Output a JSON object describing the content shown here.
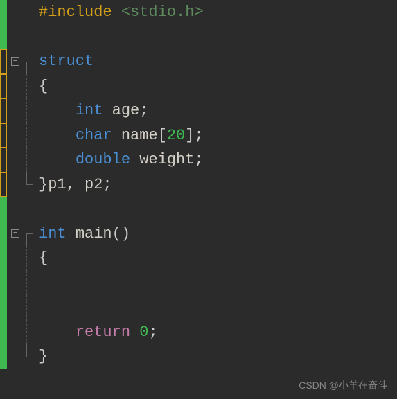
{
  "code": {
    "line1": {
      "preproc": "#include ",
      "inc_open": "<",
      "inc_path": "stdio.h",
      "inc_close": ">"
    },
    "line3": {
      "kw_struct": "struct"
    },
    "line4": {
      "brace_open": "{"
    },
    "line5": {
      "indent": "    ",
      "type": "int",
      "sp": " ",
      "ident": "age",
      "semi": ";"
    },
    "line6": {
      "indent": "    ",
      "type": "char",
      "sp": " ",
      "ident": "name",
      "bracket_open": "[",
      "num": "20",
      "bracket_close": "]",
      "semi": ";"
    },
    "line7": {
      "indent": "    ",
      "type": "double",
      "sp": " ",
      "ident": "weight",
      "semi": ";"
    },
    "line8": {
      "brace_close": "}",
      "vars": "p1, p2",
      "semi": ";"
    },
    "line10": {
      "type": "int",
      "sp": " ",
      "func": "main",
      "parens": "()"
    },
    "line11": {
      "brace_open": "{"
    },
    "line14": {
      "indent": "    ",
      "ret": "return",
      "sp": " ",
      "num": "0",
      "semi": ";"
    },
    "line15": {
      "brace_close": "}"
    }
  },
  "fold": {
    "collapse": "−"
  },
  "watermark": "CSDN @小羊在奋斗"
}
